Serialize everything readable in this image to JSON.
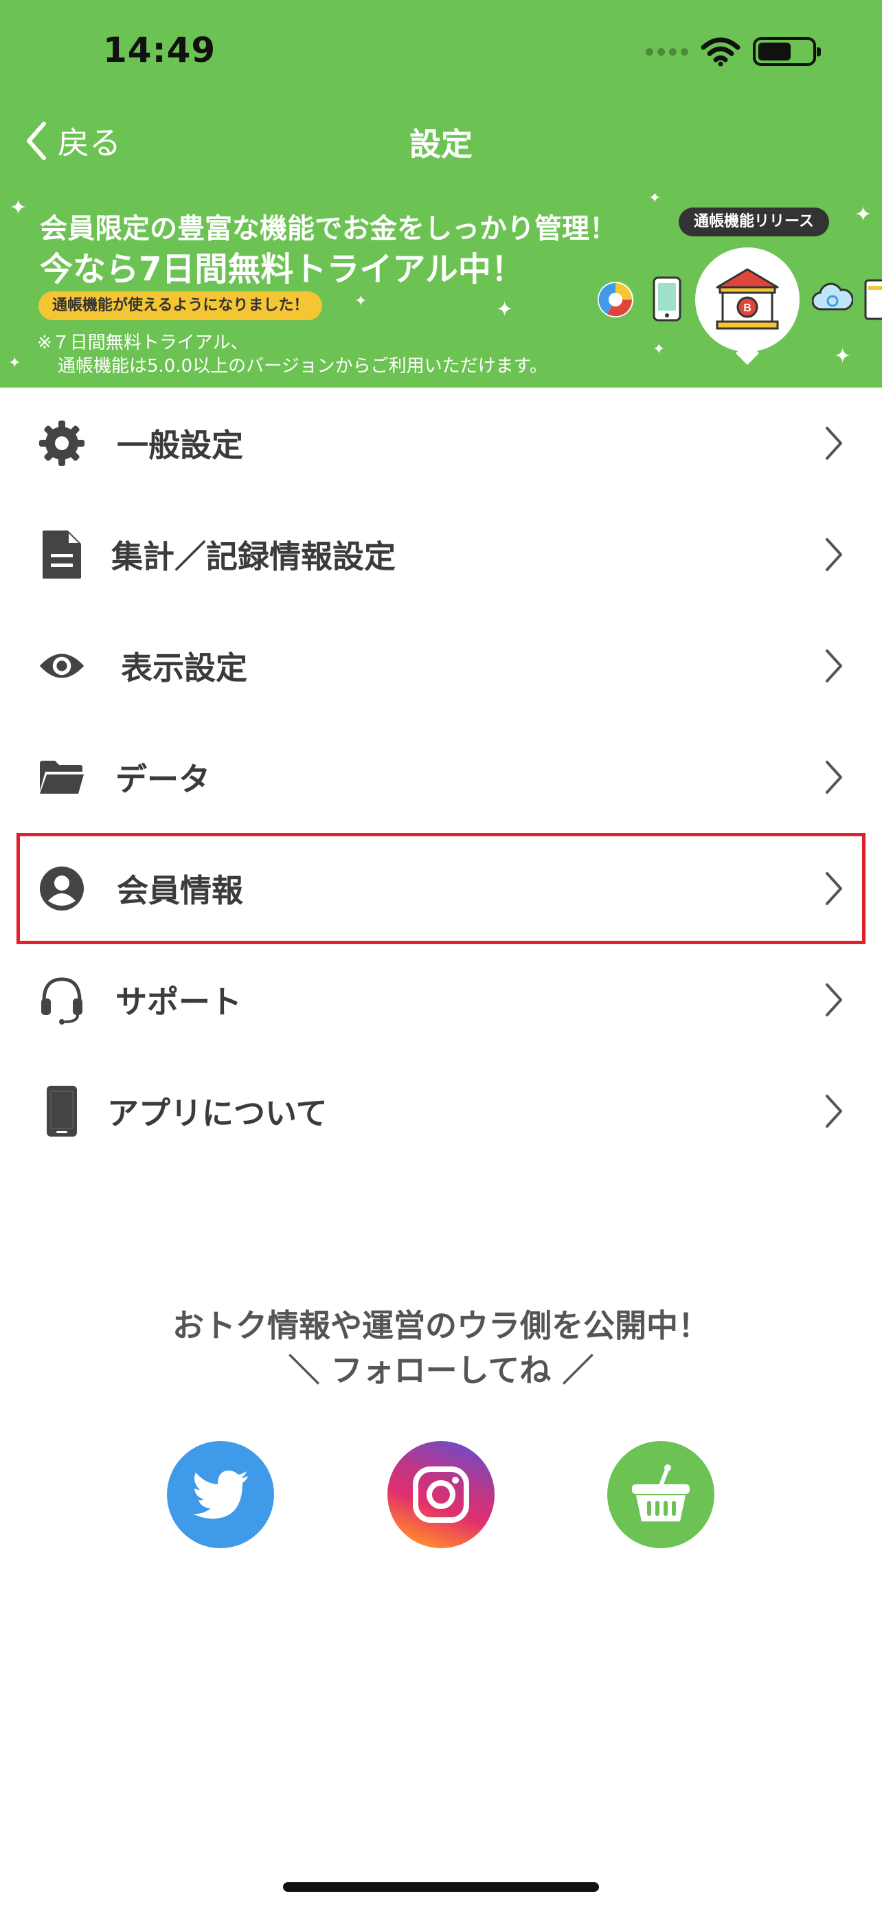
{
  "status_bar": {
    "time": "14:49"
  },
  "nav": {
    "back_label": "戻る",
    "title": "設定"
  },
  "banner": {
    "headline1": "会員限定の豊富な機能でお金をしっかり管理！",
    "headline2": "今なら7日間無料トライアル中！",
    "pill": "通帳機能が使えるようになりました！",
    "note1": "※７日間無料トライアル、",
    "note2": "通帳機能は5.0.0以上のバージョンからご利用いただけます。",
    "badge": "通帳機能リリース"
  },
  "menu": {
    "items": [
      {
        "label": "一般設定",
        "icon": "gear-icon"
      },
      {
        "label": "集計／記録情報設定",
        "icon": "document-icon"
      },
      {
        "label": "表示設定",
        "icon": "eye-icon"
      },
      {
        "label": "データ",
        "icon": "folder-icon"
      },
      {
        "label": "会員情報",
        "icon": "user-circle-icon"
      },
      {
        "label": "サポート",
        "icon": "headset-icon"
      },
      {
        "label": "アプリについて",
        "icon": "phone-icon"
      }
    ]
  },
  "sns": {
    "line1": "おトク情報や運営のウラ側を公開中！",
    "line2": "＼ フォローしてね ／",
    "buttons": [
      "twitter-icon",
      "instagram-icon",
      "shop-basket-icon"
    ]
  },
  "colors": {
    "brand_green": "#6cc353",
    "highlight_red": "#e0202a",
    "twitter_blue": "#3f9ae9"
  }
}
